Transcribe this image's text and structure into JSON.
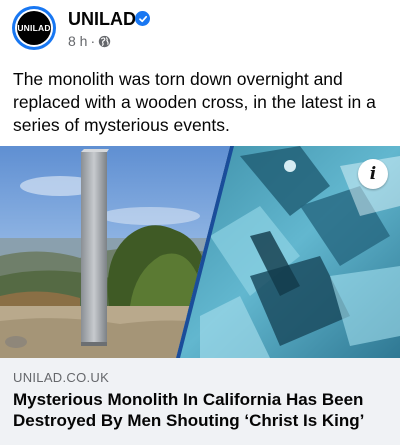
{
  "post": {
    "page_name": "UNILAD",
    "avatar_text": "UNILAD",
    "time": "8 h",
    "separator": "·",
    "caption": "The monolith was torn down overnight and replaced with a wooden cross, in the latest in a series of mysterious events."
  },
  "media": {
    "info_glyph": "i"
  },
  "link_preview": {
    "domain": "UNILAD.CO.UK",
    "headline": "Mysterious Monolith In California Has Been Destroyed By Men Shouting ‘Christ Is King’"
  },
  "icons": {
    "verified": "verified-badge-icon",
    "audience": "globe-icon",
    "info": "info-icon"
  },
  "colors": {
    "brand_blue": "#1877f2",
    "secondary_text": "#65676b",
    "card_background": "#f0f2f5"
  }
}
